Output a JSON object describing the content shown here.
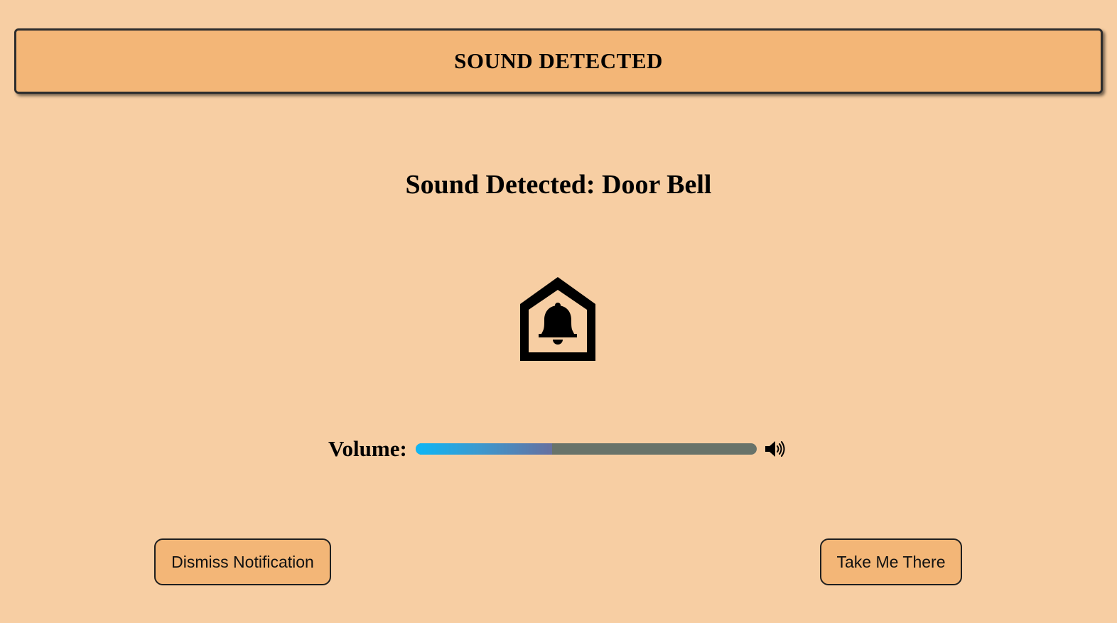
{
  "banner": {
    "title": "SOUND DETECTED"
  },
  "notification": {
    "headline": "Sound Detected: Door Bell",
    "icon": "doorbell-home-icon"
  },
  "volume": {
    "label": "Volume:",
    "level_fraction": 0.4,
    "icon": "speaker-volume-icon"
  },
  "actions": {
    "dismiss_label": "Dismiss Notification",
    "take_me_there_label": "Take Me There"
  },
  "colors": {
    "background": "#f7cea3",
    "banner": "#f3b677",
    "button": "#f3b677",
    "volume_fill_start": "#0db6f5",
    "volume_fill_end": "#6670a0",
    "volume_track": "#68736a"
  }
}
